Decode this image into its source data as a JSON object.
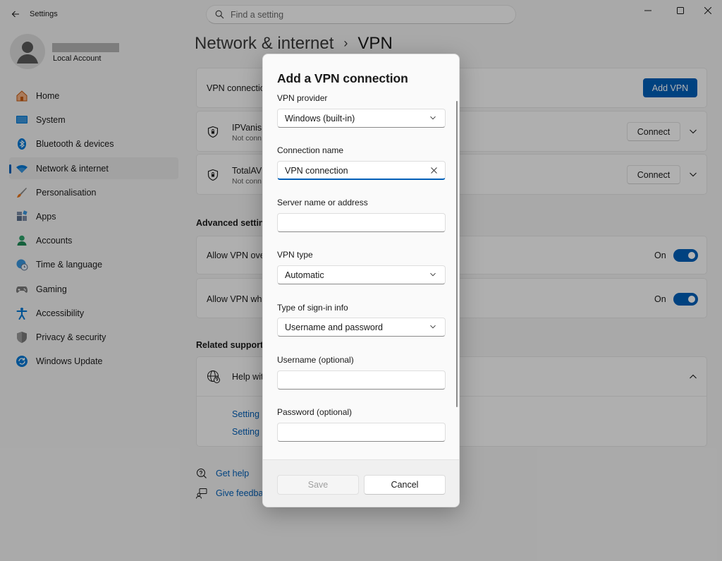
{
  "window": {
    "app_title": "Settings",
    "search_placeholder": "Find a setting"
  },
  "account": {
    "type": "Local Account"
  },
  "sidebar": {
    "items": [
      {
        "label": "Home",
        "icon": "home-icon"
      },
      {
        "label": "System",
        "icon": "monitor-icon"
      },
      {
        "label": "Bluetooth & devices",
        "icon": "bluetooth-icon"
      },
      {
        "label": "Network & internet",
        "icon": "wifi-icon",
        "active": true
      },
      {
        "label": "Personalisation",
        "icon": "brush-icon"
      },
      {
        "label": "Apps",
        "icon": "apps-icon"
      },
      {
        "label": "Accounts",
        "icon": "person-icon"
      },
      {
        "label": "Time & language",
        "icon": "globe-clock-icon"
      },
      {
        "label": "Gaming",
        "icon": "gamepad-icon"
      },
      {
        "label": "Accessibility",
        "icon": "accessibility-icon"
      },
      {
        "label": "Privacy & security",
        "icon": "shield-icon"
      },
      {
        "label": "Windows Update",
        "icon": "update-icon"
      }
    ]
  },
  "header": {
    "parent": "Network & internet",
    "separator": "›",
    "current": "VPN"
  },
  "vpn": {
    "connections_label": "VPN connectio",
    "add_button": "Add VPN",
    "profiles": [
      {
        "name": "IPVanish",
        "status": "Not conn",
        "connect_label": "Connect"
      },
      {
        "name": "TotalAV",
        "status": "Not conn",
        "connect_label": "Connect"
      }
    ]
  },
  "advanced": {
    "title": "Advanced setting",
    "rows": [
      {
        "label": "Allow VPN over",
        "state": "On"
      },
      {
        "label": "Allow VPN whil",
        "state": "On"
      }
    ]
  },
  "support": {
    "title": "Related support",
    "help_label": "Help wit",
    "links": [
      "Setting",
      "Setting"
    ]
  },
  "footer_links": {
    "get_help": "Get help",
    "feedback": "Give feedbac"
  },
  "dialog": {
    "title": "Add a VPN connection",
    "provider_label": "VPN provider",
    "provider_value": "Windows (built-in)",
    "connection_name_label": "Connection name",
    "connection_name_value": "VPN connection",
    "server_label": "Server name or address",
    "server_value": "",
    "vpn_type_label": "VPN type",
    "vpn_type_value": "Automatic",
    "signin_label": "Type of sign-in info",
    "signin_value": "Username and password",
    "username_label": "Username (optional)",
    "username_value": "",
    "password_label": "Password (optional)",
    "password_value": "",
    "save_label": "Save",
    "cancel_label": "Cancel"
  },
  "colors": {
    "accent": "#005fb8",
    "overlay": "rgba(0,0,0,0.30)"
  }
}
